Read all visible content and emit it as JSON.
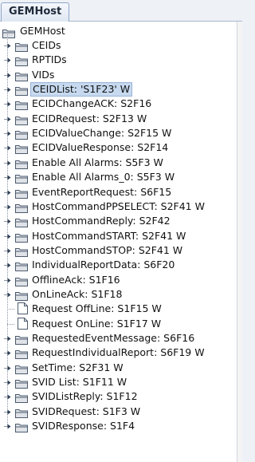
{
  "tab": {
    "label": "GEMHost"
  },
  "tree": {
    "root": {
      "label": "GEMHost",
      "icon": "folder-open-icon"
    },
    "items": [
      {
        "label": "CEIDs",
        "type": "folder"
      },
      {
        "label": "RPTIDs",
        "type": "folder"
      },
      {
        "label": "VIDs",
        "type": "folder"
      },
      {
        "label": "CEIDList: 'S1F23' W",
        "type": "folder",
        "selected": true
      },
      {
        "label": "ECIDChangeACK: S2F16",
        "type": "folder"
      },
      {
        "label": "ECIDRequest: S2F13 W",
        "type": "folder"
      },
      {
        "label": "ECIDValueChange: S2F15 W",
        "type": "folder"
      },
      {
        "label": "ECIDValueResponse: S2F14",
        "type": "folder"
      },
      {
        "label": "Enable All Alarms: S5F3 W",
        "type": "folder"
      },
      {
        "label": "Enable All Alarms_0: S5F3 W",
        "type": "folder"
      },
      {
        "label": "EventReportRequest: S6F15",
        "type": "folder"
      },
      {
        "label": "HostCommandPPSELECT: S2F41 W",
        "type": "folder"
      },
      {
        "label": "HostCommandReply: S2F42",
        "type": "folder"
      },
      {
        "label": "HostCommandSTART: S2F41 W",
        "type": "folder"
      },
      {
        "label": "HostCommandSTOP: S2F41 W",
        "type": "folder"
      },
      {
        "label": "IndividualReportData: S6F20",
        "type": "folder"
      },
      {
        "label": "OfflineAck: S1F16",
        "type": "folder"
      },
      {
        "label": "OnLineAck: S1F18",
        "type": "folder"
      },
      {
        "label": "Request OffLine: S1F15 W",
        "type": "doc"
      },
      {
        "label": "Request OnLine: S1F17 W",
        "type": "doc"
      },
      {
        "label": "RequestedEventMessage: S6F16",
        "type": "folder"
      },
      {
        "label": "RequestIndividualReport: S6F19 W",
        "type": "folder"
      },
      {
        "label": "SetTime: S2F31 W",
        "type": "folder"
      },
      {
        "label": "SVID List: S1F11 W",
        "type": "folder"
      },
      {
        "label": "SVIDListReply: S1F12",
        "type": "folder"
      },
      {
        "label": "SVIDRequest: S1F3 W",
        "type": "folder"
      },
      {
        "label": "SVIDResponse: S1F4",
        "type": "folder"
      }
    ]
  },
  "colors": {
    "selection": "#c6d9ef",
    "folder_fill": "#dfe3e8",
    "folder_stroke": "#4b5a6d",
    "tab_border": "#8da6c9"
  }
}
